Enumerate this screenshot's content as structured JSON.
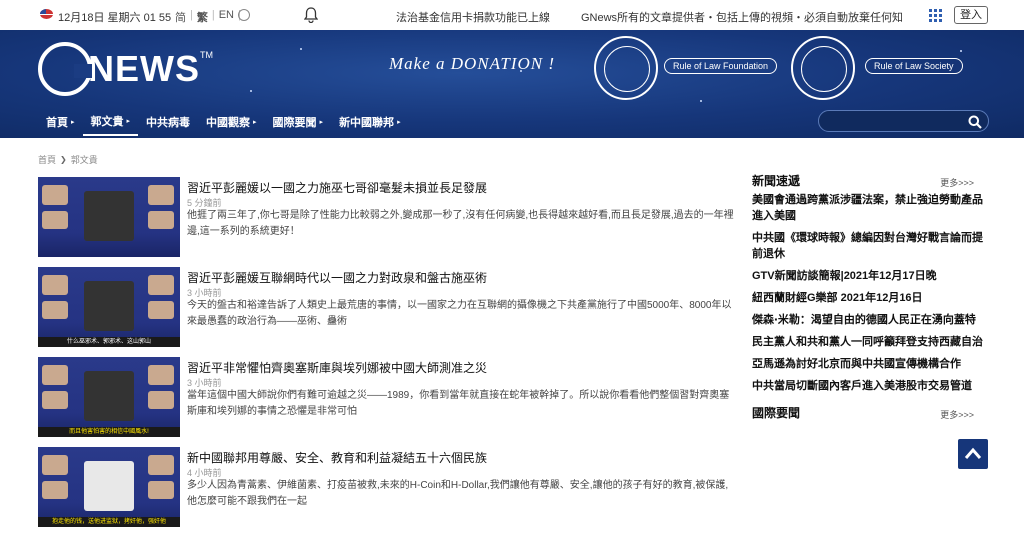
{
  "topbar": {
    "date": "12月18日 星期六 01 55",
    "langs": [
      "简",
      "繁",
      "EN"
    ],
    "news1": "法治基金信用卡捐款功能已上線",
    "news2": "GNews所有的文章提供者・包括上傳的視頻・必須自動放棄任何知",
    "login": "登入"
  },
  "banner": {
    "logo": "NEWS",
    "tm": "TM",
    "donate": "Make a DONATION !",
    "pill1": "Rule of Law Foundation",
    "pill2": "Rule of Law Society"
  },
  "nav": [
    {
      "label": "首頁",
      "caret": "▸"
    },
    {
      "label": "郭文貴",
      "caret": "▸"
    },
    {
      "label": "中共病毒",
      "caret": ""
    },
    {
      "label": "中國觀察",
      "caret": "▸"
    },
    {
      "label": "國際要聞",
      "caret": "▸"
    },
    {
      "label": "新中國聯邦",
      "caret": "▸"
    }
  ],
  "breadcrumb": {
    "home": "首頁",
    "sep": "❯",
    "current": "郭文貴"
  },
  "articles": [
    {
      "title": "習近平彭麗媛以一國之力施巫七哥卻毫髮未損並長足發展",
      "time": "5 分鐘前",
      "summary": "他捱了兩三年了,你七哥是除了性能力比較弱之外,變成那一秒了,沒有任何病變,也長得越來越好看,而且長足發展,過去的一年裡邊,這一系列的系統更好！",
      "caption": ""
    },
    {
      "title": "習近平彭麗媛互聯網時代以一國之力對政泉和盤古施巫術",
      "time": "3 小時前",
      "summary": "今天的盤古和裕達告訴了人類史上最荒唐的事情，以一國家之力在互聯網的攝像機之下共產黨施行了中國5000年、8000年以來最愚蠢的政治行為——巫術、蠱術",
      "caption": "什么巫邪术、郭邪术、这山郭山"
    },
    {
      "title": "習近平非常懼怕齊奧塞斯庫與埃列娜被中國大師測准之災",
      "time": "3 小時前",
      "summary": "當年這個中國大師說你們有難可逾越之災——1989，你看到當年就直接在蛇年被幹掉了。所以說你看看他們整個習對齊奧塞斯庫和埃列娜的事情之恐懼是非常可怕",
      "caption": "而且他害怕害的相信中國風水!"
    },
    {
      "title": "新中國聯邦用尊嚴、安全、教育和利益凝結五十六個民族",
      "time": "4 小時前",
      "summary": "多少人因為青蒿素、伊維菌素、打疫苗被救,未來的H-Coin和H-Dollar,我們讓他有尊嚴、安全,讓他的孩子有好的教育,被保護,他怎麼可能不跟我們在一起",
      "caption": "抱走他的钱，送他进监狱，拷奸他，强奸他"
    }
  ],
  "sidebar": {
    "section1": "新聞速遞",
    "more": "更多>>>",
    "items": [
      "美國會通過跨黨派涉疆法案，禁止強迫勞動產品進入美國",
      "中共國《環球時報》總編因對台灣好戰言論而提前退休",
      "GTV新聞訪談簡報|2021年12月17日晚",
      "紐西蘭財經G樂部 2021年12月16日",
      "傑森‧米勒：渴望自由的德國人民正在湧向蓋特",
      "民主黨人和共和黨人一同呼籲拜登支持西藏自治",
      "亞馬遜為討好北京而與中共國宣傳機構合作",
      "中共當局切斷國內客戶進入美港股市交易管道"
    ],
    "section2": "國際要聞",
    "more2": "更多>>>"
  }
}
